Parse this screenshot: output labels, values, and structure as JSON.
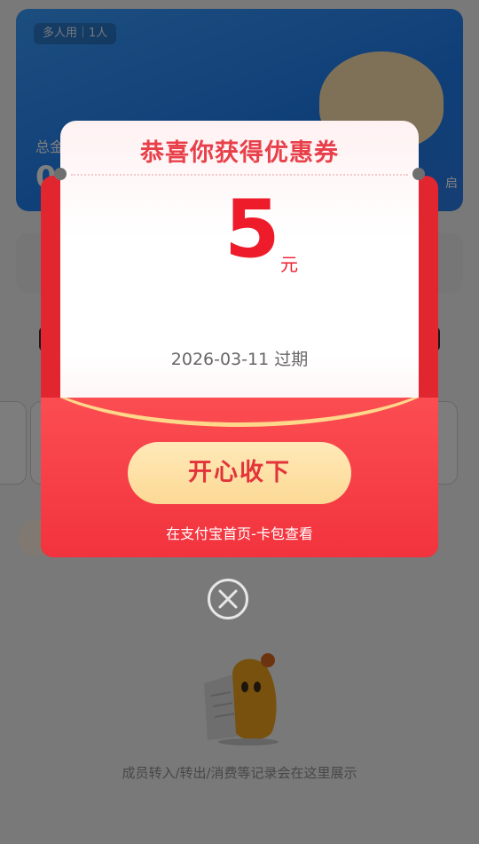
{
  "background": {
    "card_tag": "多人用｜1人",
    "total_label": "总金",
    "total_value": "0",
    "right_partial": "启",
    "empty_text": "成员转入/转出/消费等记录会在这里展示"
  },
  "coupon": {
    "title": "恭喜你获得优惠券",
    "amount": "5",
    "unit": "元",
    "expiry": "2026-03-11 过期",
    "accept_label": "开心收下",
    "hint": "在支付宝首页-卡包查看"
  },
  "icons": {
    "close": "close-icon",
    "mascot": "mascot-illustration"
  },
  "colors": {
    "accent_red": "#ee1c2b",
    "title_red": "#e8404a",
    "envelope_red": "#f2333e",
    "button_gold": "#fcd995",
    "card_blue": "#1f7ef0"
  }
}
